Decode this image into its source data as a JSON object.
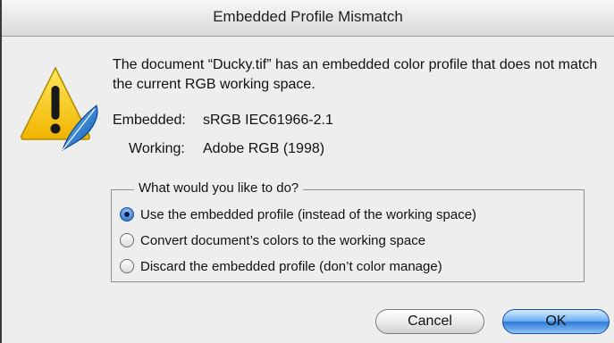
{
  "dialog": {
    "title": "Embedded Profile Mismatch",
    "message": "The document “Ducky.tif” has an embedded color profile that does not match the current RGB working space.",
    "embedded": {
      "label": "Embedded:",
      "value": "sRGB IEC61966-2.1"
    },
    "working": {
      "label": "Working:",
      "value": "Adobe RGB (1998)"
    },
    "choice": {
      "legend": "What would you like to do?",
      "selected_index": 0,
      "options": [
        {
          "label": "Use the embedded profile (instead of the working space)",
          "selected": true
        },
        {
          "label": "Convert document’s colors to the working space",
          "selected": false
        },
        {
          "label": "Discard the embedded profile (don’t color manage)",
          "selected": false
        }
      ]
    },
    "buttons": {
      "cancel": "Cancel",
      "ok": "OK"
    },
    "icons": {
      "alert": "warning-icon",
      "badge": "feather-quill-icon"
    },
    "colors": {
      "default_button": "#3a86e0",
      "warning": "#f5c800"
    }
  }
}
